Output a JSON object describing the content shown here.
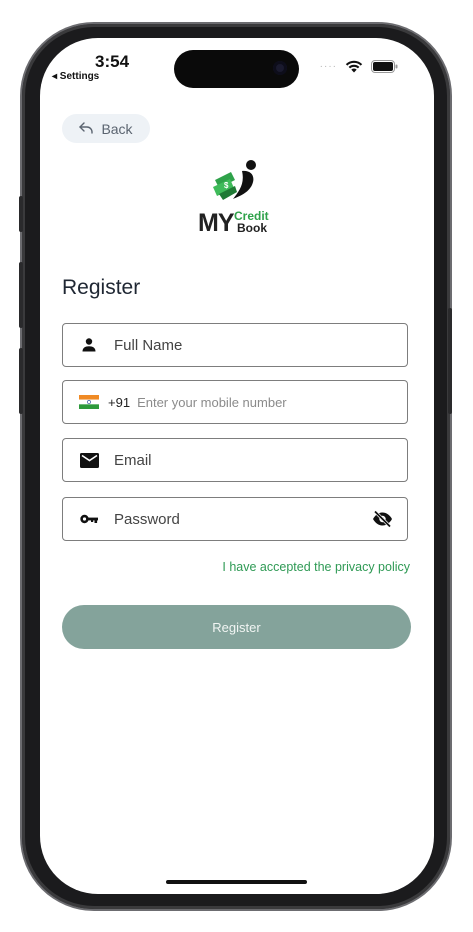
{
  "status_bar": {
    "time": "3:54",
    "back_app": "◂ Settings",
    "signal_dots": "····"
  },
  "back_button": {
    "label": "Back"
  },
  "logo": {
    "my": "MY",
    "credit": "Credit",
    "book": "Book"
  },
  "page_title": "Register",
  "form": {
    "full_name_placeholder": "Full Name",
    "country_code": "+91",
    "mobile_placeholder": "Enter your mobile number",
    "email_placeholder": "Email",
    "password_placeholder": "Password"
  },
  "privacy_link": "I have accepted the privacy policy",
  "register_button": "Register",
  "colors": {
    "accent_green": "#2f9a55",
    "button_bg": "#84a39b",
    "title": "#1f2733"
  },
  "icons": [
    "back-arrow-icon",
    "person-icon",
    "india-flag-icon",
    "mail-icon",
    "key-icon",
    "eye-off-icon",
    "wifi-icon",
    "battery-icon"
  ]
}
